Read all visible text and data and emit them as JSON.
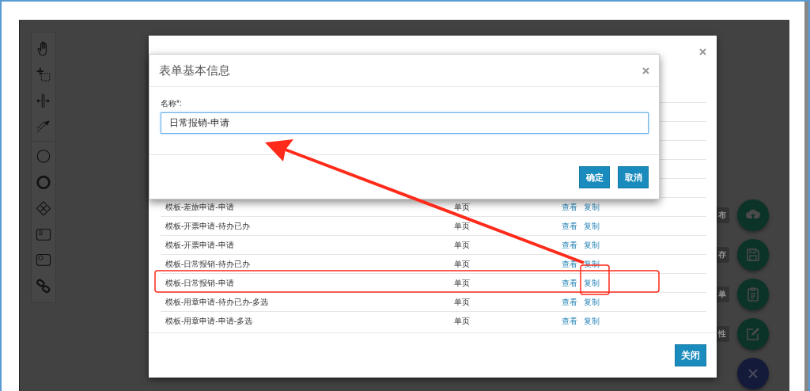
{
  "fab_actions": [
    {
      "kind": "action",
      "label": "布"
    },
    {
      "kind": "action",
      "label": "存"
    },
    {
      "kind": "action",
      "label": "单"
    },
    {
      "kind": "action",
      "label": "性"
    },
    {
      "kind": "close"
    }
  ],
  "form_list_dialog": {
    "rows": [
      {
        "name": "模板-差旅申请-申请",
        "type": "单页",
        "actions": [
          "查看",
          "复制"
        ]
      },
      {
        "name": "模板-开票申请-待办已办",
        "type": "单页",
        "actions": [
          "查看",
          "复制"
        ]
      },
      {
        "name": "模板-开票申请-申请",
        "type": "单页",
        "actions": [
          "查看",
          "复制"
        ]
      },
      {
        "name": "模板-日常报销-待办已办",
        "type": "单页",
        "actions": [
          "查看",
          "复制"
        ]
      },
      {
        "name": "模板-日常报销-申请",
        "type": "单页",
        "actions": [
          "查看",
          "复制"
        ]
      },
      {
        "name": "模板-用章申请-待办已办-多选",
        "type": "单页",
        "actions": [
          "查看",
          "复制"
        ]
      },
      {
        "name": "模板-用章申请-申请-多选",
        "type": "单页",
        "actions": [
          "查看",
          "复制"
        ]
      }
    ],
    "close_button": "关闭"
  },
  "form_info_dialog": {
    "title": "表单基本信息",
    "field": {
      "label": "名称*:",
      "value": "日常报销-申请"
    },
    "buttons": [
      "确定",
      "取消"
    ]
  }
}
